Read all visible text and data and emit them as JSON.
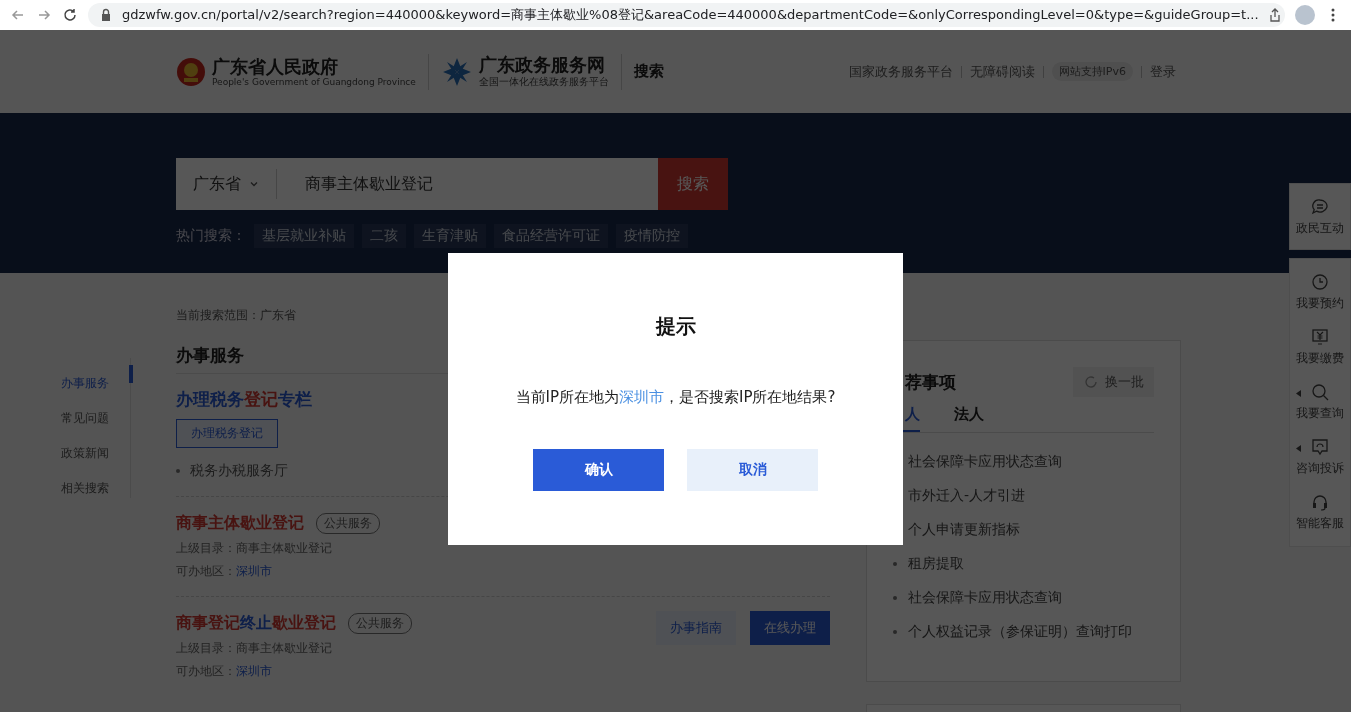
{
  "browser": {
    "url": "gdzwfw.gov.cn/portal/v2/search?region=440000&keyword=商事主体歇业%08登记&areaCode=440000&departmentCode=&onlyCorrespondingLevel=0&type=&guideGroup=t..."
  },
  "header": {
    "gov_name": "广东省人民政府",
    "gov_subtitle": "People's Government of Guangdong Province",
    "site_name": "广东政务服务网",
    "site_subtitle": "全国一体化在线政务服务平台",
    "section": "搜索",
    "links": [
      {
        "label": "国家政务服务平台",
        "kind": "link"
      },
      {
        "label": "无障碍阅读",
        "kind": "link"
      },
      {
        "label": "网站支持IPv6",
        "kind": "badge"
      },
      {
        "label": "登录",
        "kind": "link"
      }
    ]
  },
  "search": {
    "region": "广东省",
    "value": "商事主体歇业登记",
    "button": "搜索",
    "hot_label": "热门搜索：",
    "hot_terms": [
      "基层就业补贴",
      "二孩",
      "生育津贴",
      "食品经营许可证",
      "疫情防控"
    ]
  },
  "sidebar": {
    "items": [
      {
        "label": "办事服务",
        "selected": true
      },
      {
        "label": "常见问题",
        "selected": false
      },
      {
        "label": "政策新闻",
        "selected": false
      },
      {
        "label": "相关搜索",
        "selected": false
      }
    ]
  },
  "results": {
    "scope": "当前搜索范围：广东省",
    "heading": "办事服务",
    "column": {
      "title_parts": [
        {
          "text": "办理税务",
          "highlight": false
        },
        {
          "text": "登记",
          "highlight": true
        },
        {
          "text": "专栏",
          "highlight": false
        }
      ],
      "button": "办理税务登记",
      "links": [
        "税务办税服务厅"
      ]
    },
    "items": [
      {
        "title_parts": [
          {
            "text": "商事主体歇业登记",
            "highlight": true
          }
        ],
        "tag": "公共服务",
        "catalog": "上级目录：商事主体歇业登记",
        "area_label": "可办地区：",
        "area": "深圳市"
      },
      {
        "title_parts": [
          {
            "text": "商事登记",
            "highlight": true
          },
          {
            "text": "终止",
            "highlight": false
          },
          {
            "text": "歇业登记",
            "highlight": true
          }
        ],
        "tag": "公共服务",
        "catalog": "上级目录：商事主体歇业登记",
        "area_label": "可办地区：",
        "area": "深圳市",
        "buttons": [
          {
            "label": "办事指南",
            "kind": "secondary"
          },
          {
            "label": "在线办理",
            "kind": "primary"
          }
        ]
      }
    ]
  },
  "recommend": {
    "title": "荐事项",
    "refresh": "换一批",
    "tabs": [
      {
        "label": "人",
        "selected": true
      },
      {
        "label": "法人",
        "selected": false
      }
    ],
    "items": [
      {
        "label": "社会保障卡应用状态查询",
        "kind": "plain"
      },
      {
        "label": "市外迁入-人才引进",
        "kind": "plain"
      },
      {
        "label": "个人申请更新指标",
        "kind": "plain"
      },
      {
        "label": "租房提取",
        "kind": "bulleted"
      },
      {
        "label": "社会保障卡应用状态查询",
        "kind": "bulleted"
      },
      {
        "label": "个人权益记录（参保证明）查询打印",
        "kind": "bulleted"
      }
    ]
  },
  "float_menu": {
    "items": [
      {
        "label": "政民互动",
        "kind": "chat",
        "has_submenu": false
      },
      {
        "label": "我要预约",
        "kind": "clock",
        "has_submenu": false
      },
      {
        "label": "我要缴费",
        "kind": "yen",
        "has_submenu": false
      },
      {
        "label": "我要查询",
        "kind": "search",
        "has_submenu": true
      },
      {
        "label": "咨询投诉",
        "kind": "message",
        "has_submenu": true
      },
      {
        "label": "智能客服",
        "kind": "headset",
        "has_submenu": false
      }
    ]
  },
  "dialog": {
    "title": "提示",
    "message_before": "当前IP所在地为",
    "message_link": "深圳市",
    "message_after": "，是否搜索IP所在地结果?",
    "buttons": [
      {
        "label": "确认",
        "kind": "primary"
      },
      {
        "label": "取消",
        "kind": "secondary"
      }
    ]
  }
}
